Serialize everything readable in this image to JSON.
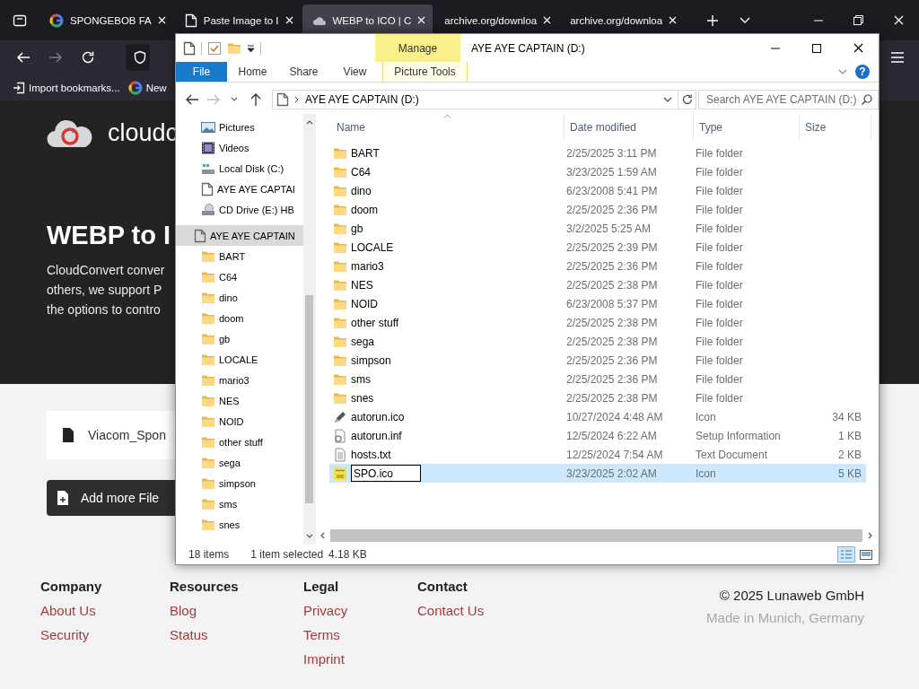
{
  "browser": {
    "tabs": [
      {
        "title": "SPONGEBOB FA",
        "kind": "google",
        "selected": false
      },
      {
        "title": "Paste Image to I",
        "kind": "page",
        "selected": false
      },
      {
        "title": "WEBP to ICO | C",
        "kind": "cloud",
        "selected": true
      },
      {
        "title": "archive.org/downloa",
        "kind": "plain",
        "selected": false
      },
      {
        "title": "archive.org/downloa",
        "kind": "plain",
        "selected": false
      }
    ],
    "bookmarks": [
      {
        "label": "Import bookmarks...",
        "kind": "import"
      },
      {
        "label": "New",
        "kind": "google"
      }
    ]
  },
  "page": {
    "logo_text": "cloudc",
    "heading": "WEBP to I",
    "intro_lines": [
      "CloudConvert conver",
      "others, we support P",
      "the options to contro"
    ],
    "file_name": "Viacom_Spon",
    "add_button": "Add more File"
  },
  "footer": {
    "columns": [
      {
        "heading": "Company",
        "links": [
          "About Us",
          "Security"
        ]
      },
      {
        "heading": "Resources",
        "links": [
          "Blog",
          "Status"
        ]
      },
      {
        "heading": "Legal",
        "links": [
          "Privacy",
          "Terms",
          "Imprint"
        ]
      },
      {
        "heading": "Contact",
        "links": [
          "Contact Us"
        ]
      }
    ],
    "copyright": "© 2025 Lunaweb GmbH",
    "location": "Made in Munich, Germany"
  },
  "explorer": {
    "title": "AYE AYE CAPTAIN (D:)",
    "context_tab": "Manage",
    "help_glyph": "?",
    "ribbon_tabs": [
      {
        "label": "File",
        "kind": "file"
      },
      {
        "label": "Home",
        "kind": "plain"
      },
      {
        "label": "Share",
        "kind": "plain"
      },
      {
        "label": "View",
        "kind": "plain"
      },
      {
        "label": "Picture Tools",
        "kind": "context"
      }
    ],
    "address": "AYE AYE CAPTAIN (D:)",
    "search_placeholder": "Search AYE AYE CAPTAIN (D:)",
    "nav": [
      {
        "label": "Pictures",
        "kind": "pictures",
        "selected": false
      },
      {
        "label": "Videos",
        "kind": "videos",
        "selected": false
      },
      {
        "label": "Local Disk (C:)",
        "kind": "disk",
        "selected": false
      },
      {
        "label": "AYE AYE CAPTAI",
        "kind": "drive",
        "selected": false
      },
      {
        "label": "CD Drive (E:) HB",
        "kind": "cd",
        "selected": false
      },
      {
        "label": "AYE AYE CAPTAIN",
        "kind": "drive",
        "selected": true,
        "children": [
          {
            "label": "BART",
            "kind": "folder",
            "selected": false
          },
          {
            "label": "C64",
            "kind": "folder",
            "selected": false
          },
          {
            "label": "dino",
            "kind": "folder",
            "selected": false
          },
          {
            "label": "doom",
            "kind": "folder",
            "selected": false
          },
          {
            "label": "gb",
            "kind": "folder",
            "selected": false
          },
          {
            "label": "LOCALE",
            "kind": "folder",
            "selected": false
          },
          {
            "label": "mario3",
            "kind": "folder",
            "selected": false
          },
          {
            "label": "NES",
            "kind": "folder",
            "selected": false
          },
          {
            "label": "NOID",
            "kind": "folder",
            "selected": false
          },
          {
            "label": "other stuff",
            "kind": "folder",
            "selected": false
          },
          {
            "label": "sega",
            "kind": "folder",
            "selected": false
          },
          {
            "label": "simpson",
            "kind": "folder",
            "selected": false
          },
          {
            "label": "sms",
            "kind": "folder",
            "selected": false
          },
          {
            "label": "snes",
            "kind": "folder",
            "selected": false
          }
        ]
      }
    ],
    "columns": [
      "Name",
      "Date modified",
      "Type",
      "Size"
    ],
    "rows": [
      {
        "name": "BART",
        "date": "2/25/2025 3:11 PM",
        "type": "File folder",
        "kind": "folder",
        "selected": false,
        "editing": false
      },
      {
        "name": "C64",
        "date": "3/23/2025 1:59 AM",
        "type": "File folder",
        "kind": "folder",
        "selected": false,
        "editing": false
      },
      {
        "name": "dino",
        "date": "6/23/2008 5:41 PM",
        "type": "File folder",
        "kind": "folder",
        "selected": false,
        "editing": false
      },
      {
        "name": "doom",
        "date": "2/25/2025 2:36 PM",
        "type": "File folder",
        "kind": "folder",
        "selected": false,
        "editing": false
      },
      {
        "name": "gb",
        "date": "3/2/2025 5:25 AM",
        "type": "File folder",
        "kind": "folder",
        "selected": false,
        "editing": false
      },
      {
        "name": "LOCALE",
        "date": "2/25/2025 2:39 PM",
        "type": "File folder",
        "kind": "folder",
        "selected": false,
        "editing": false
      },
      {
        "name": "mario3",
        "date": "2/25/2025 2:36 PM",
        "type": "File folder",
        "kind": "folder",
        "selected": false,
        "editing": false
      },
      {
        "name": "NES",
        "date": "2/25/2025 2:38 PM",
        "type": "File folder",
        "kind": "folder",
        "selected": false,
        "editing": false
      },
      {
        "name": "NOID",
        "date": "6/23/2008 5:37 PM",
        "type": "File folder",
        "kind": "folder",
        "selected": false,
        "editing": false
      },
      {
        "name": "other stuff",
        "date": "2/25/2025 2:38 PM",
        "type": "File folder",
        "kind": "folder",
        "selected": false,
        "editing": false
      },
      {
        "name": "sega",
        "date": "2/25/2025 2:38 PM",
        "type": "File folder",
        "kind": "folder",
        "selected": false,
        "editing": false
      },
      {
        "name": "simpson",
        "date": "2/25/2025 2:36 PM",
        "type": "File folder",
        "kind": "folder",
        "selected": false,
        "editing": false
      },
      {
        "name": "sms",
        "date": "2/25/2025 2:36 PM",
        "type": "File folder",
        "kind": "folder",
        "selected": false,
        "editing": false
      },
      {
        "name": "snes",
        "date": "2/25/2025 2:38 PM",
        "type": "File folder",
        "kind": "folder",
        "selected": false,
        "editing": false
      },
      {
        "name": "autorun.ico",
        "date": "10/27/2024 4:48 AM",
        "type": "Icon",
        "size": "34 KB",
        "kind": "pen",
        "selected": false,
        "editing": false
      },
      {
        "name": "autorun.inf",
        "date": "12/5/2024 6:22 AM",
        "type": "Setup Information",
        "size": "1 KB",
        "kind": "setup",
        "selected": false,
        "editing": false
      },
      {
        "name": "hosts.txt",
        "date": "12/25/2024 7:54 AM",
        "type": "Text Document",
        "size": "2 KB",
        "kind": "text",
        "selected": false,
        "editing": false
      },
      {
        "name": "SPO.ico",
        "date": "3/23/2025 2:02 AM",
        "type": "Icon",
        "size": "5 KB",
        "kind": "thumbnail",
        "selected": true,
        "editing": true
      }
    ],
    "status": {
      "count": "18 items",
      "selection": "1 item selected",
      "size": "4.18 KB"
    }
  }
}
